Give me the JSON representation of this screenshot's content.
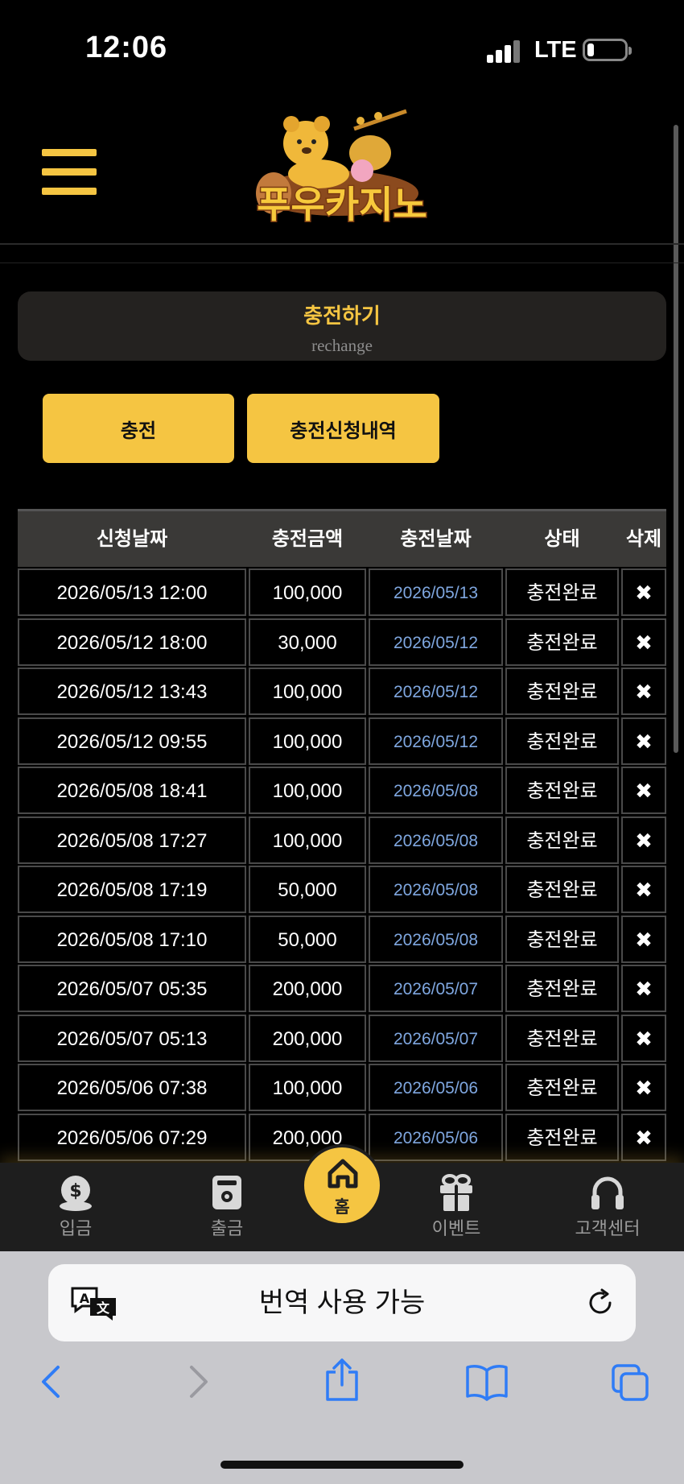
{
  "status_bar": {
    "time": "12:06",
    "network": "LTE"
  },
  "header": {
    "logo_text": "푸우카지노"
  },
  "title_panel": {
    "title": "충전하기",
    "subtitle": "rechange"
  },
  "buttons": {
    "charge": "충전",
    "history": "충전신청내역"
  },
  "table": {
    "headers": [
      "신청날짜",
      "충전금액",
      "충전날짜",
      "상태",
      "삭제"
    ],
    "rows": [
      {
        "requested": "2026/05/13 12:00",
        "amount": "100,000",
        "charged": "2026/05/13",
        "status": "충전완료",
        "delete": "✖"
      },
      {
        "requested": "2026/05/12 18:00",
        "amount": "30,000",
        "charged": "2026/05/12",
        "status": "충전완료",
        "delete": "✖"
      },
      {
        "requested": "2026/05/12 13:43",
        "amount": "100,000",
        "charged": "2026/05/12",
        "status": "충전완료",
        "delete": "✖"
      },
      {
        "requested": "2026/05/12 09:55",
        "amount": "100,000",
        "charged": "2026/05/12",
        "status": "충전완료",
        "delete": "✖"
      },
      {
        "requested": "2026/05/08 18:41",
        "amount": "100,000",
        "charged": "2026/05/08",
        "status": "충전완료",
        "delete": "✖"
      },
      {
        "requested": "2026/05/08 17:27",
        "amount": "100,000",
        "charged": "2026/05/08",
        "status": "충전완료",
        "delete": "✖"
      },
      {
        "requested": "2026/05/08 17:19",
        "amount": "50,000",
        "charged": "2026/05/08",
        "status": "충전완료",
        "delete": "✖"
      },
      {
        "requested": "2026/05/08 17:10",
        "amount": "50,000",
        "charged": "2026/05/08",
        "status": "충전완료",
        "delete": "✖"
      },
      {
        "requested": "2026/05/07 05:35",
        "amount": "200,000",
        "charged": "2026/05/07",
        "status": "충전완료",
        "delete": "✖"
      },
      {
        "requested": "2026/05/07 05:13",
        "amount": "200,000",
        "charged": "2026/05/07",
        "status": "충전완료",
        "delete": "✖"
      },
      {
        "requested": "2026/05/06 07:38",
        "amount": "100,000",
        "charged": "2026/05/06",
        "status": "충전완료",
        "delete": "✖"
      },
      {
        "requested": "2026/05/06 07:29",
        "amount": "200,000",
        "charged": "2026/05/06",
        "status": "충전완료",
        "delete": "✖"
      }
    ]
  },
  "bottom_nav": {
    "deposit": "입금",
    "withdraw": "출금",
    "home": "홈",
    "event": "이벤트",
    "support": "고객센터"
  },
  "safari": {
    "translate_text": "번역 사용 가능"
  },
  "colors": {
    "accent": "#f5c542",
    "date_link": "#7fa7e0"
  }
}
